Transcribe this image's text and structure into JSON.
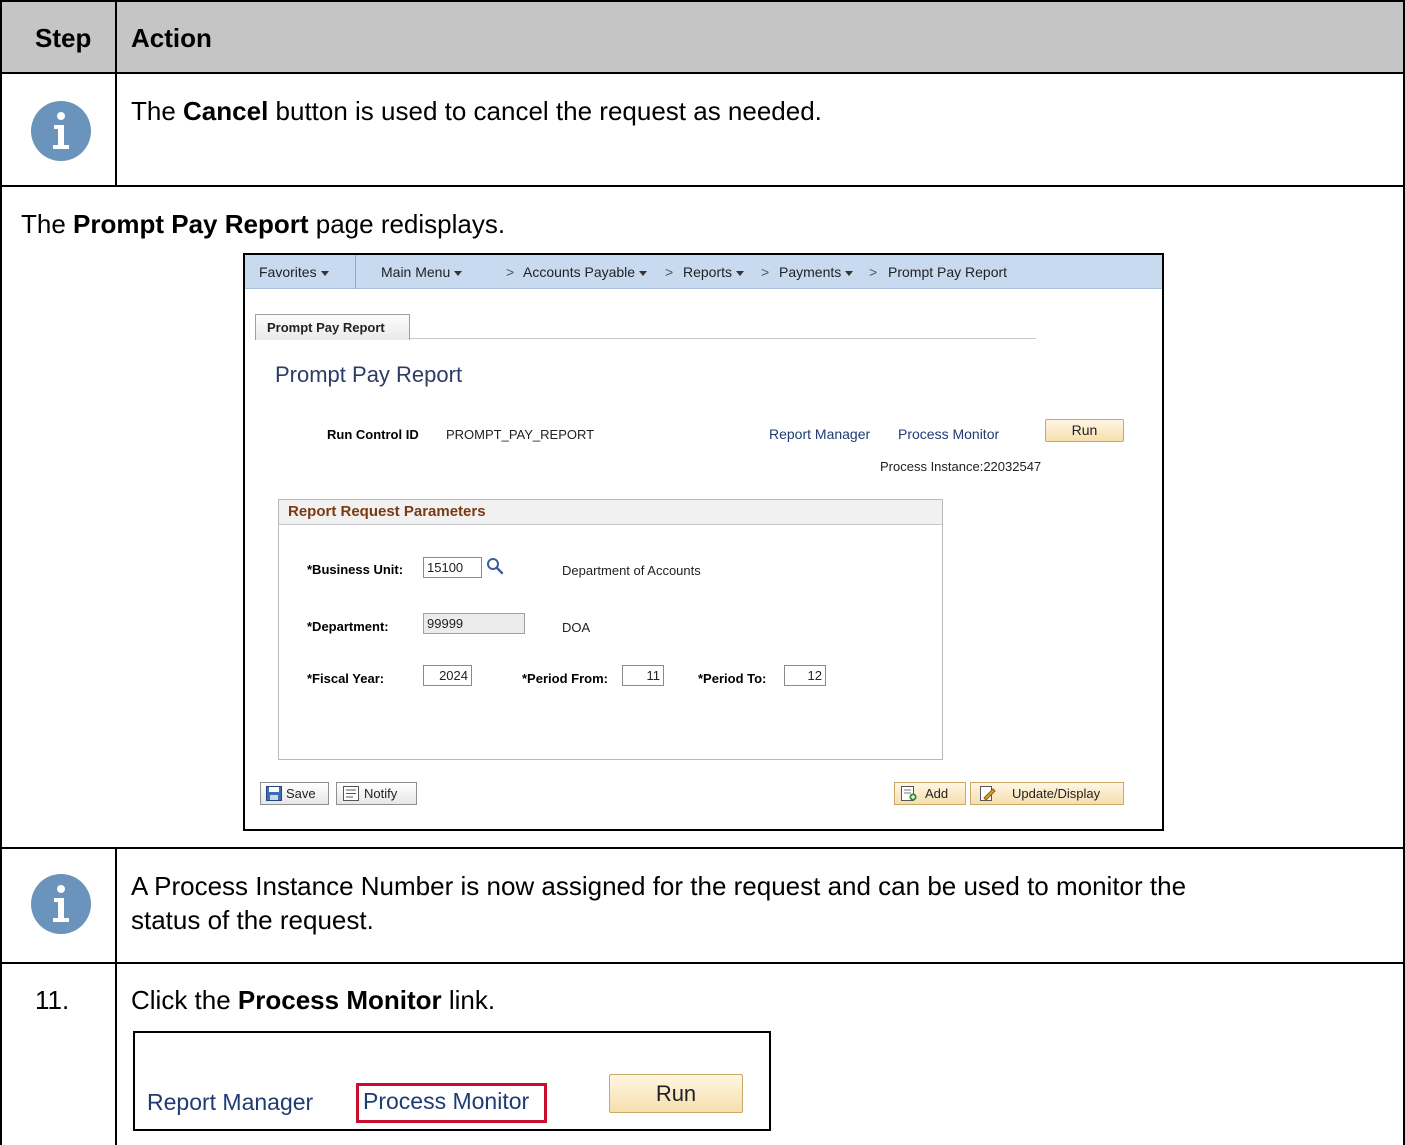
{
  "table": {
    "header": {
      "step": "Step",
      "action": "Action"
    },
    "row1": {
      "pre": "The ",
      "bold": "Cancel",
      "post": " button is used to cancel the request as needed."
    },
    "row2": {
      "pre": "The ",
      "bold": "Prompt Pay Report",
      "post": " page redisplays."
    },
    "row3": {
      "line1": "A Process Instance Number is now assigned for the request and can be used to monitor the",
      "line2": "status of the request."
    },
    "row4": {
      "step": "11.",
      "pre": "Click the ",
      "bold": "Process Monitor",
      "post": " link."
    }
  },
  "screenshot": {
    "nav": {
      "favorites": "Favorites",
      "main_menu": "Main Menu",
      "accounts_payable": "Accounts Payable",
      "reports": "Reports",
      "payments": "Payments",
      "current": "Prompt Pay Report",
      "separator": ">"
    },
    "tab_label": "Prompt Pay Report",
    "page_title": "Prompt Pay Report",
    "run_control_label": "Run Control ID",
    "run_control_value": "PROMPT_PAY_REPORT",
    "report_manager": "Report Manager",
    "process_monitor": "Process Monitor",
    "run": "Run",
    "process_instance": "Process Instance:22032547",
    "group_title": "Report Request Parameters",
    "business_unit_label": "*Business Unit:",
    "business_unit_value": "15100",
    "business_unit_desc": "Department of Accounts",
    "department_label": "*Department:",
    "department_value": "99999",
    "department_desc": "DOA",
    "fiscal_year_label": "*Fiscal Year:",
    "fiscal_year_value": "2024",
    "period_from_label": "*Period From:",
    "period_from_value": "11",
    "period_to_label": "*Period To:",
    "period_to_value": "12",
    "save": "Save",
    "notify": "Notify",
    "add": "Add",
    "update_display": "Update/Display"
  },
  "zoom": {
    "report_manager": "Report Manager",
    "process_monitor": "Process Monitor",
    "run": "Run"
  },
  "icons": [
    "info-icon",
    "search-icon",
    "save-icon",
    "notify-icon",
    "add-icon",
    "update-display-icon"
  ],
  "colors": {
    "header_bg": "#c5c5c5",
    "info_icon": "#6a94bb",
    "nav_bg": "#c8daf0",
    "link": "#1f3c72",
    "highlight": "#c8102e"
  }
}
